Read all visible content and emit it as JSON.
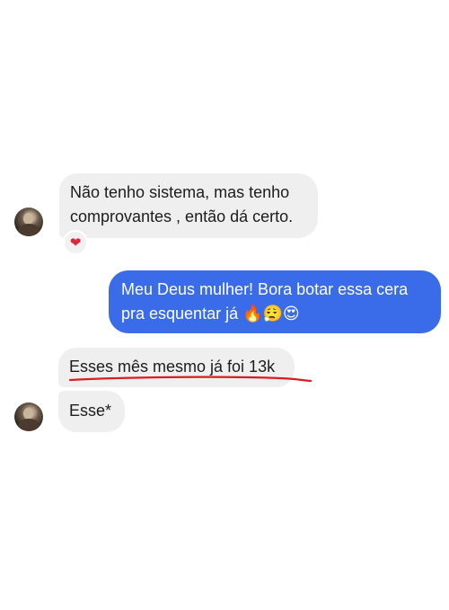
{
  "conversation": {
    "messages": [
      {
        "sender": "other",
        "lines": [
          "Não tenho sistema, mas tenho",
          "comprovantes , então dá certo."
        ],
        "reaction": "❤"
      },
      {
        "sender": "me",
        "lines": [
          "Meu Deus mulher! Bora botar essa cera",
          "pra esquentar já 🔥😮‍💨😍"
        ]
      },
      {
        "sender": "other",
        "lines": [
          "Esses mês mesmo já foi 13k"
        ],
        "annotation": "red-underline"
      },
      {
        "sender": "other",
        "lines": [
          "Esse*"
        ]
      }
    ]
  },
  "colors": {
    "outgoing_bubble": "#3a6be8",
    "incoming_bubble": "#efefef",
    "annotation_line": "#d81f1f",
    "reaction_heart": "#e0243b"
  },
  "icons": {
    "reaction": "heart-icon",
    "avatar": "contact-avatar"
  }
}
